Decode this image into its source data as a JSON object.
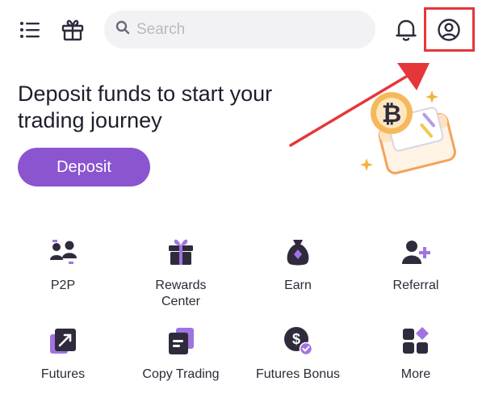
{
  "topbar": {
    "search": {
      "placeholder": "Search",
      "value": ""
    },
    "icons": [
      "menu-icon",
      "gift-icon",
      "search-icon",
      "bell-icon",
      "profile-icon"
    ]
  },
  "banner": {
    "title": "Deposit funds to start your trading journey",
    "deposit_label": "Deposit"
  },
  "colors": {
    "accent": "#8a55cf",
    "dark_icon": "#2f2b3d",
    "highlight": "#e5373a",
    "coin": "#f2b23d"
  },
  "features": [
    {
      "label": "P2P",
      "icon": "p2p-icon"
    },
    {
      "label": "Rewards Center",
      "icon": "rewards-icon"
    },
    {
      "label": "Earn",
      "icon": "earn-bag-icon"
    },
    {
      "label": "Referral",
      "icon": "referral-icon"
    },
    {
      "label": "Futures",
      "icon": "futures-icon"
    },
    {
      "label": "Copy Trading",
      "icon": "copy-trading-icon"
    },
    {
      "label": "Futures Bonus",
      "icon": "futures-bonus-icon"
    },
    {
      "label": "More",
      "icon": "more-grid-icon"
    }
  ]
}
